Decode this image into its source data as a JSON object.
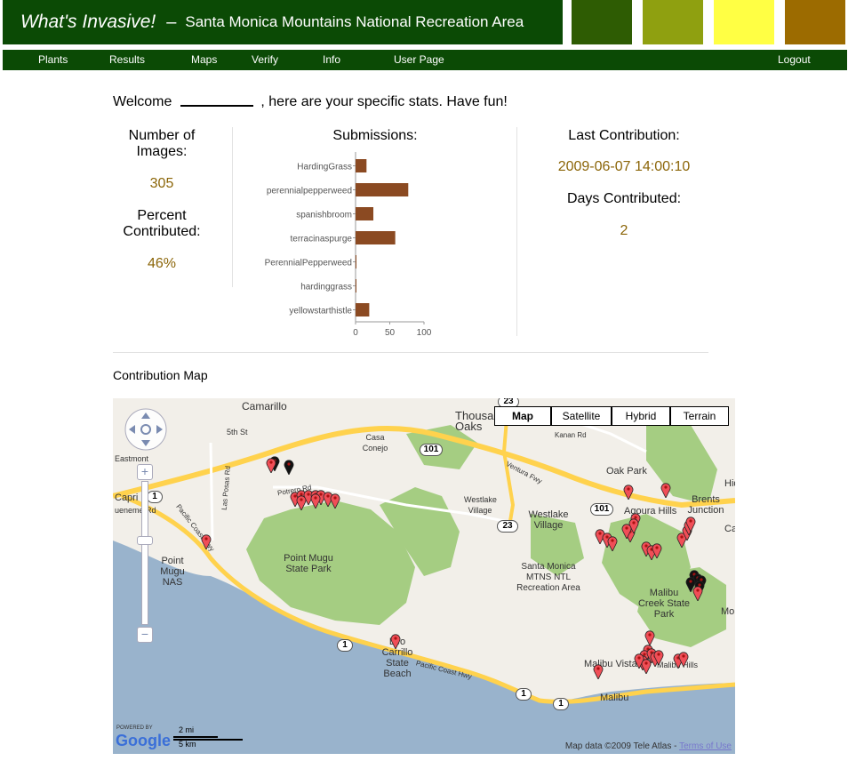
{
  "header": {
    "brand": "What's Invasive!",
    "dash": "–",
    "subtitle": "Santa Monica Mountains National Recreation Area",
    "swatches": [
      "#2e5c03",
      "#8fa010",
      "#ffff44",
      "#9c6b00"
    ]
  },
  "nav": {
    "items": [
      "Plants",
      "Results",
      "Maps",
      "Verify",
      "Info",
      "User Page"
    ],
    "logout": "Logout"
  },
  "welcome": {
    "before": "Welcome",
    "after": ", here are your specific stats. Have fun!"
  },
  "stats": {
    "num_images_label": "Number of Images:",
    "num_images_value": "305",
    "percent_label": "Percent Contributed:",
    "percent_value": "46%",
    "submissions_label": "Submissions:",
    "last_contribution_label": "Last Contribution:",
    "last_contribution_value": "2009-06-07 14:00:10",
    "days_label": "Days Contributed:",
    "days_value": "2"
  },
  "chart_data": {
    "type": "bar",
    "orientation": "horizontal",
    "title": "Submissions:",
    "categories": [
      "HardingGrass",
      "perennialpepperweed",
      "spanishbroom",
      "terracinaspurge",
      "PerennialPepperweed",
      "hardinggrass",
      "yellowstarthistle"
    ],
    "values": [
      16,
      77,
      26,
      58,
      1,
      1,
      20
    ],
    "xlim": [
      0,
      100
    ],
    "xticks": [
      0,
      50,
      100
    ],
    "bar_color": "#8b4a22",
    "grid": false,
    "legend": "none"
  },
  "map": {
    "title": "Contribution Map",
    "types": [
      "Map",
      "Satellite",
      "Hybrid",
      "Terrain"
    ],
    "selected_type": "Map",
    "labels": [
      "Camarillo",
      "5th St",
      "Eastmont",
      "Casa Conejo",
      "Thousand Oaks",
      "Kanan Rd",
      "Oak Park",
      "Ventura Fwy",
      "Westlake Village",
      "Westlake Village",
      "Agoura Hills",
      "Brents Junction",
      "Point Mugu State Park",
      "Santa Monica MTNS NTL Recreation Area",
      "Malibu Creek State Park",
      "Point Mugu NAS",
      "Leo Carrillo State Beach",
      "Pacific Coast Hwy",
      "Malibu Vista",
      "Malibu Hills",
      "Malibu",
      "Las Posas Rd",
      "Potrero Rd",
      "Pacific Coast Hwy",
      "Hid",
      "Ca",
      "Mo",
      "Capri",
      "ueneme Rd"
    ],
    "shields": [
      "23",
      "101",
      "1",
      "101",
      "23",
      "1",
      "1",
      "1"
    ],
    "powered_by": "POWERED BY",
    "google": "Google",
    "scale_mi": "2 mi",
    "scale_km": "5 km",
    "map_data": "Map data ©2009 Tele Atlas -",
    "terms": "Terms of Use",
    "colors": {
      "water": "#99b3cc",
      "land": "#f2efe9",
      "park": "#a5cd82",
      "highway": "#ffd24d",
      "pin": "#f04e57"
    }
  }
}
